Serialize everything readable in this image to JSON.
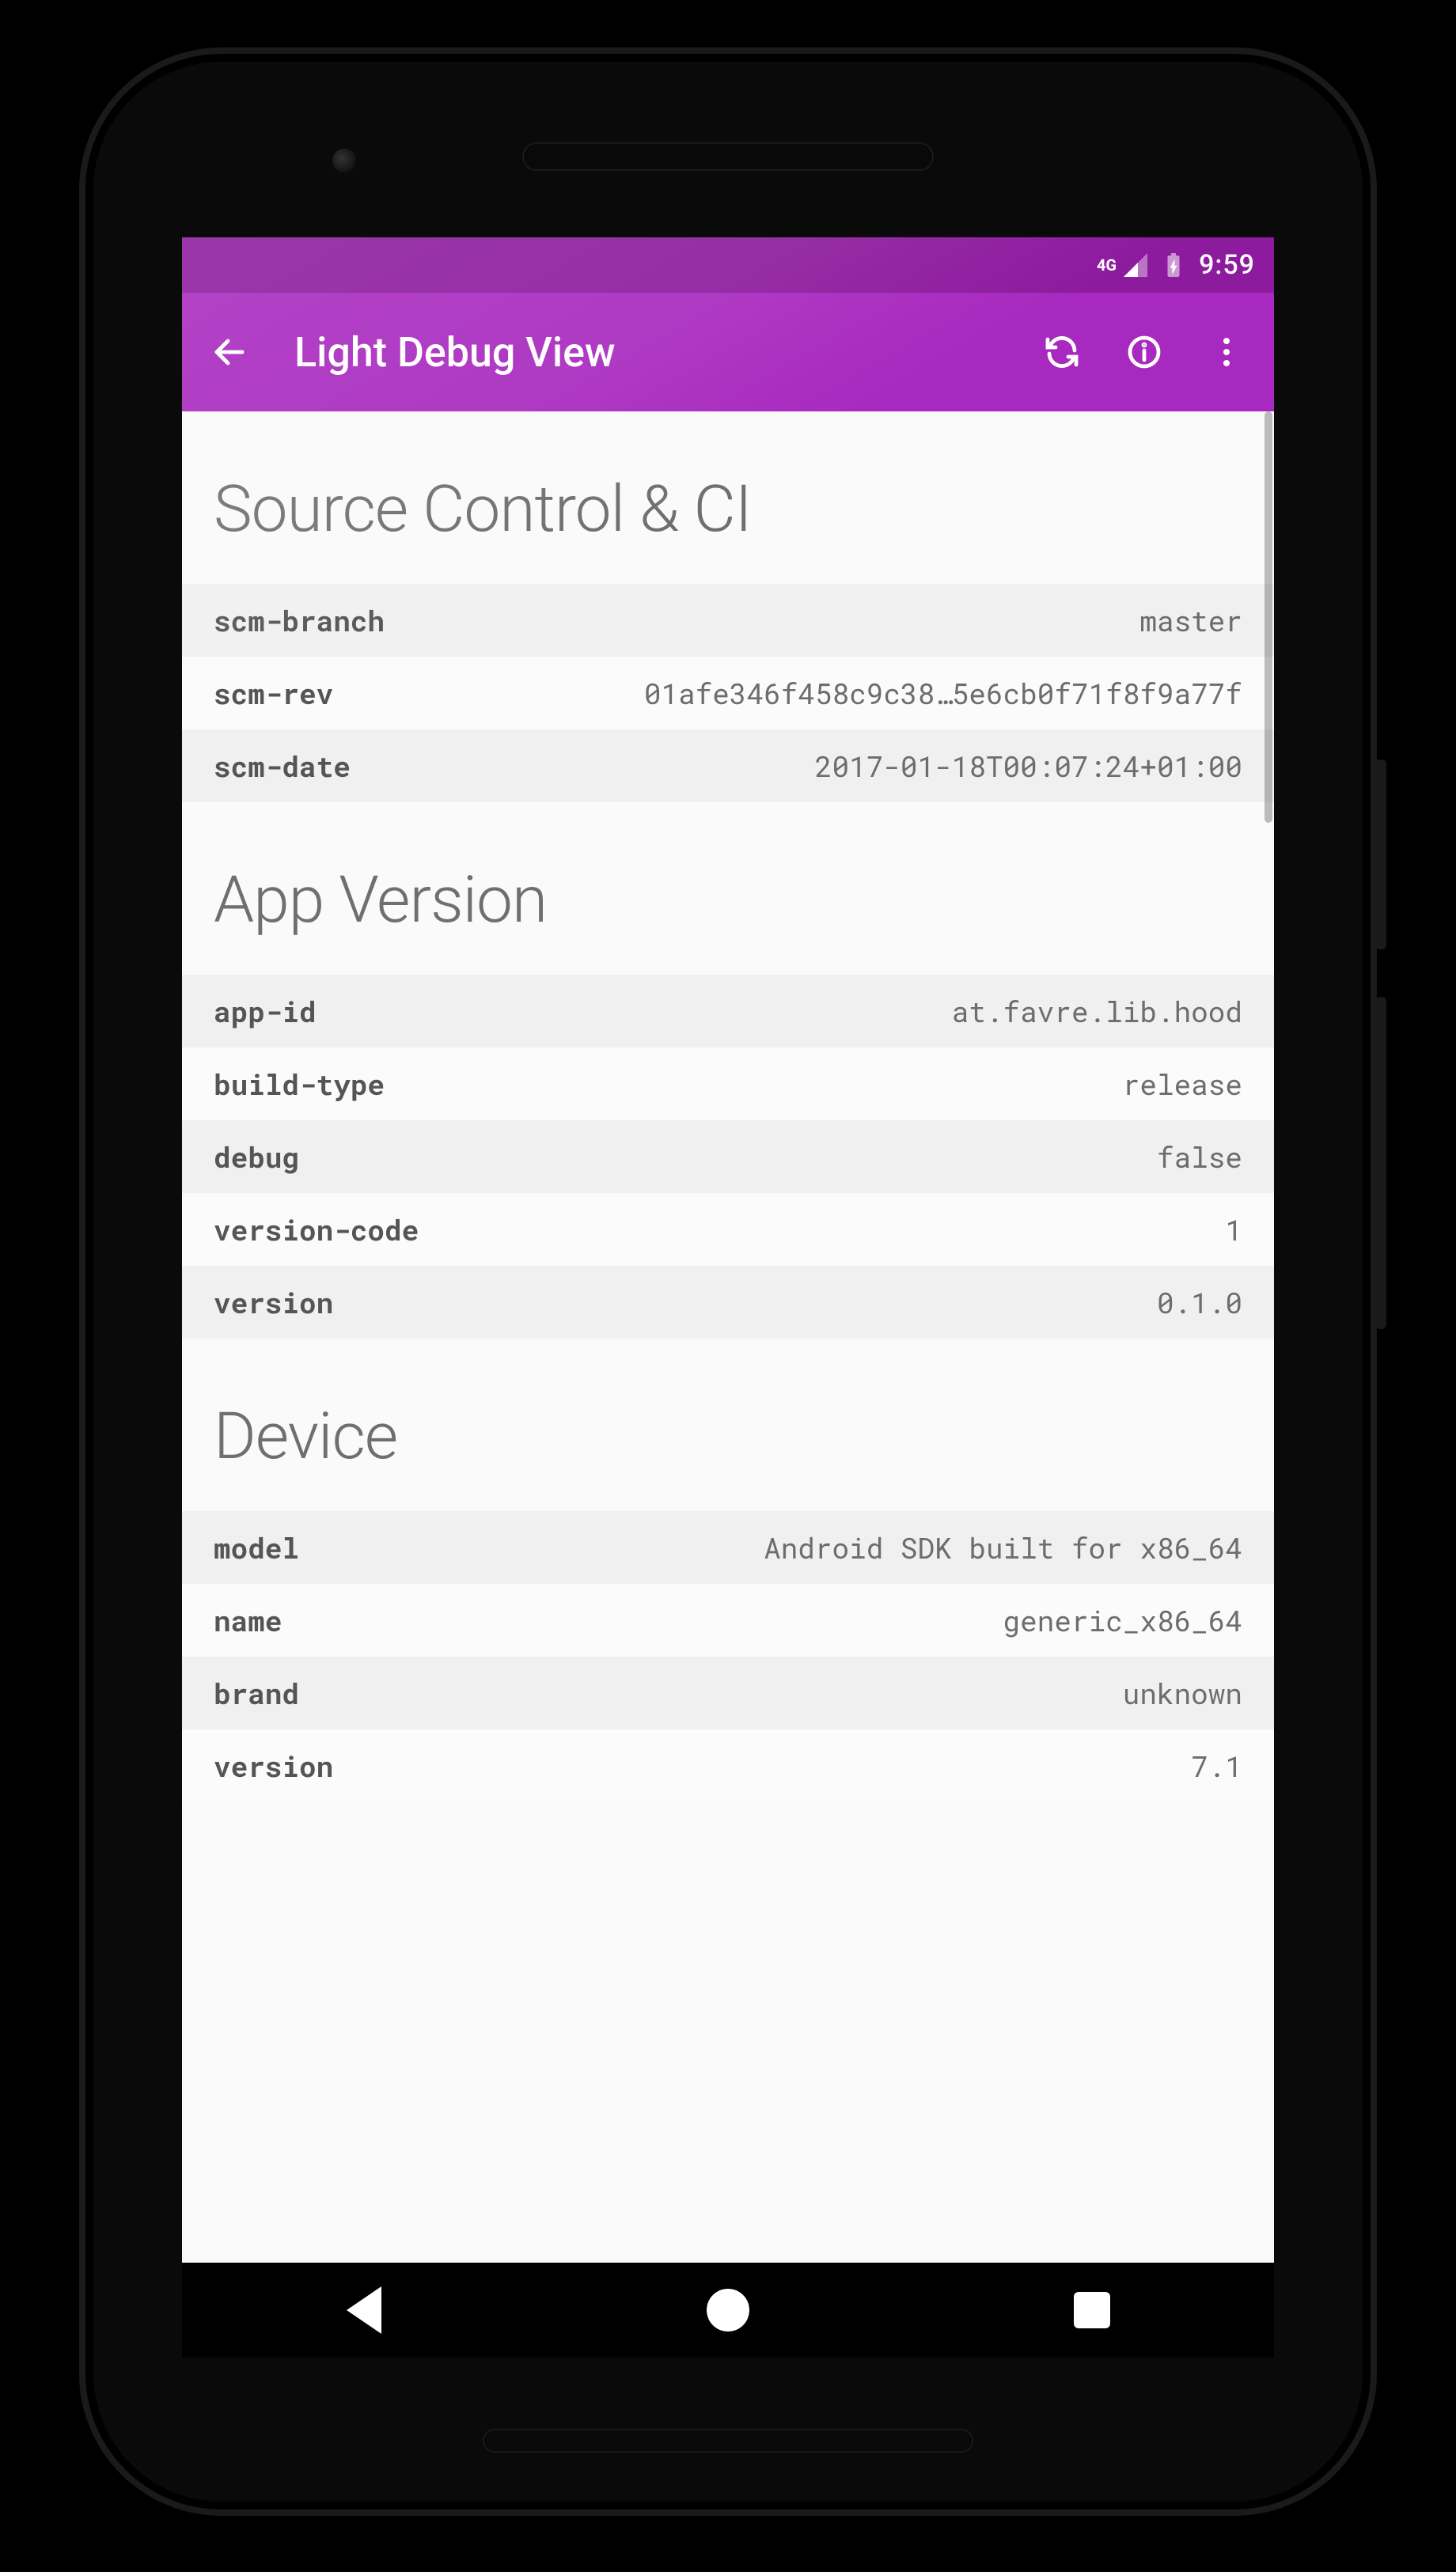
{
  "status": {
    "network": "4G",
    "time": "9:59"
  },
  "appbar": {
    "title": "Light Debug View"
  },
  "sections": [
    {
      "title": "Source Control & CI",
      "rows": [
        {
          "key": "scm-branch",
          "val": "master"
        },
        {
          "key": "scm-rev",
          "val": "01afe346f458c9c38…5e6cb0f71f8f9a77f"
        },
        {
          "key": "scm-date",
          "val": "2017-01-18T00:07:24+01:00"
        }
      ]
    },
    {
      "title": "App Version",
      "rows": [
        {
          "key": "app-id",
          "val": "at.favre.lib.hood"
        },
        {
          "key": "build-type",
          "val": "release"
        },
        {
          "key": "debug",
          "val": "false"
        },
        {
          "key": "version-code",
          "val": "1"
        },
        {
          "key": "version",
          "val": "0.1.0"
        }
      ]
    },
    {
      "title": "Device",
      "rows": [
        {
          "key": "model",
          "val": "Android SDK built for x86_64"
        },
        {
          "key": "name",
          "val": "generic_x86_64"
        },
        {
          "key": "brand",
          "val": "unknown"
        },
        {
          "key": "version",
          "val": "7.1"
        }
      ]
    }
  ]
}
